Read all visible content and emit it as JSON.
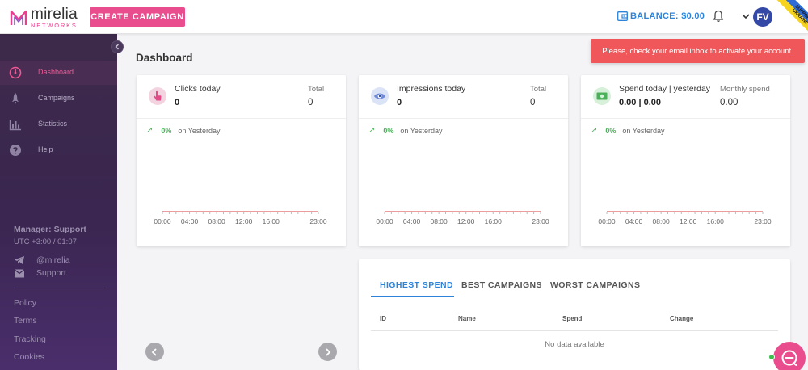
{
  "header": {
    "logo_name": "mirelia",
    "logo_sub": "NETWORKS",
    "create_campaign_label": "CREATE CAMPAIGN",
    "balance_label": "BALANCE: $0.00",
    "avatar_initials": "FV",
    "ribbon_text_1": "SUPPORT",
    "ribbon_text_2": "UKRAINE"
  },
  "sidebar": {
    "items": [
      {
        "label": "Dashboard",
        "icon": "speedometer-icon",
        "active": true
      },
      {
        "label": "Campaigns",
        "icon": "rocket-icon",
        "active": false
      },
      {
        "label": "Statistics",
        "icon": "bar-chart-icon",
        "active": false
      },
      {
        "label": "Help",
        "icon": "help-icon",
        "active": false
      }
    ],
    "manager_label": "Manager: Support",
    "utc_label": "UTC +3:00 / 01:07",
    "telegram_handle": "@mirelia",
    "support_label": "Support",
    "footer_links": [
      "Policy",
      "Terms",
      "Tracking",
      "Cookies"
    ]
  },
  "main": {
    "page_title": "Dashboard",
    "toast": "Please, check your email inbox to activate your account.",
    "cards": [
      {
        "title": "Clicks today",
        "value": "0",
        "total_label": "Total",
        "total_value": "0",
        "trend_pct": "0%",
        "trend_label": "on Yesterday",
        "icon": "pointer-click-icon",
        "accent": "#f4d3e0"
      },
      {
        "title": "Impressions today",
        "value": "0",
        "total_label": "Total",
        "total_value": "0",
        "trend_pct": "0%",
        "trend_label": "on Yesterday",
        "icon": "eye-icon",
        "accent": "#dbe3f6"
      },
      {
        "title": "Spend today | yesterday",
        "value": "0.00 | 0.00",
        "total_label": "Monthly spend",
        "total_value": "0.00",
        "trend_pct": "0%",
        "trend_label": "on Yesterday",
        "icon": "money-icon",
        "accent": "#d6f0d9"
      }
    ],
    "chart_ticks": [
      "00:00",
      "04:00",
      "08:00",
      "12:00",
      "16:00",
      "23:00"
    ],
    "tabs": [
      "HIGHEST SPEND",
      "BEST CAMPAIGNS",
      "WORST CAMPAIGNS"
    ],
    "table_headers": [
      "ID",
      "Name",
      "Spend",
      "Change"
    ],
    "no_data": "No data available"
  },
  "colors": {
    "brand": "#ea4d8d",
    "accent_blue": "#2d83d8",
    "toast": "#f0575a",
    "trend_green": "#4cb05a",
    "chart_line": "#e06565"
  }
}
